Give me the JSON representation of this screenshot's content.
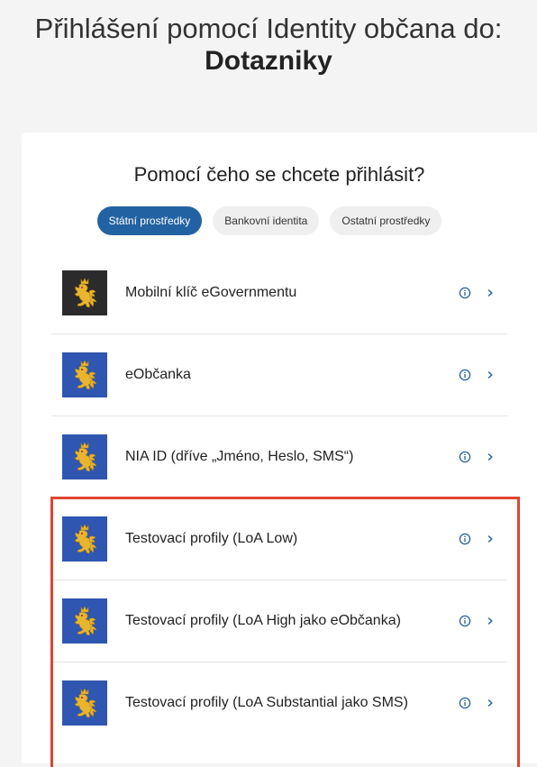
{
  "header": {
    "title_prefix": "Přihlášení pomocí Identity občana do:",
    "service_name": "Dotazniky"
  },
  "card": {
    "heading": "Pomocí čeho se chcete přihlásit?",
    "tabs": [
      {
        "label": "Státní prostředky",
        "active": true
      },
      {
        "label": "Bankovní identita",
        "active": false
      },
      {
        "label": "Ostatní prostředky",
        "active": false
      }
    ],
    "items": [
      {
        "label": "Mobilní klíč eGovernmentu",
        "logo_bg": "#2b2b2b",
        "icon": "czech-lion-icon"
      },
      {
        "label": "eObčanka",
        "logo_bg": "#2f56b0",
        "icon": "czech-lion-icon"
      },
      {
        "label": "NIA ID (dříve „Jméno, Heslo, SMS“)",
        "logo_bg": "#2f56b0",
        "icon": "czech-lion-icon"
      },
      {
        "label": "Testovací profily (LoA Low)",
        "logo_bg": "#2f56b0",
        "icon": "czech-lion-icon"
      },
      {
        "label": "Testovací profily (LoA High jako eObčanka)",
        "logo_bg": "#2f56b0",
        "icon": "czech-lion-icon"
      },
      {
        "label": "Testovací profily (LoA Substantial jako SMS)",
        "logo_bg": "#2f56b0",
        "icon": "czech-lion-icon"
      }
    ]
  },
  "colors": {
    "accent": "#2362a2",
    "highlight": "#e0452e",
    "lion_gold": "#e9b52f"
  }
}
